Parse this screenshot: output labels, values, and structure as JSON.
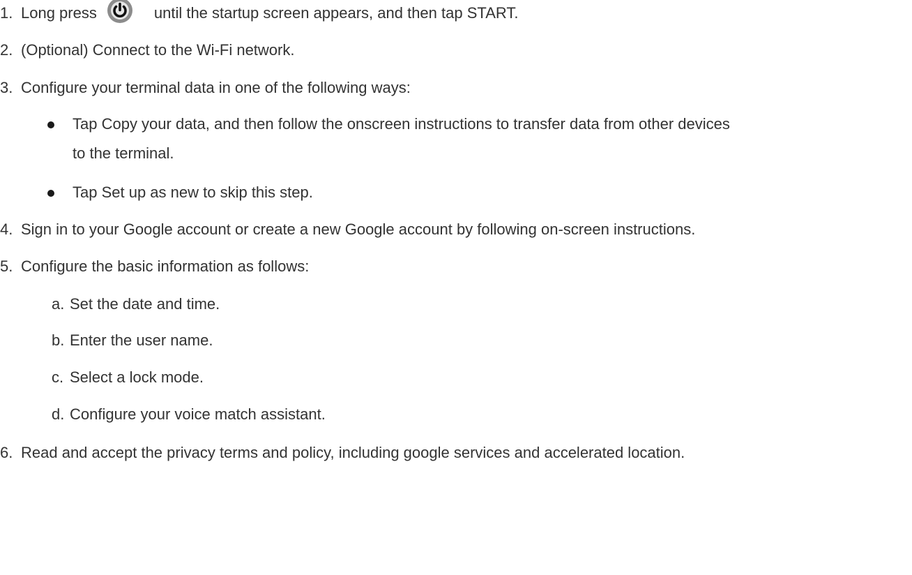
{
  "steps": [
    {
      "num": "1.",
      "before": "Long press",
      "after": "until the startup screen appears, and then tap START.",
      "icon": "power-icon"
    },
    {
      "num": "2.",
      "text": "(Optional) Connect to the Wi-Fi network."
    },
    {
      "num": "3.",
      "text": "Configure your terminal data in one of the following ways:"
    },
    {
      "num": "4.",
      "text": "Sign in to your Google account or create a new Google account by following on-screen instructions."
    },
    {
      "num": "5.",
      "text": "Configure the basic information as follows:"
    },
    {
      "num": "6.",
      "text": "Read and accept the privacy terms and policy, including google services and accelerated location."
    }
  ],
  "bullets": [
    {
      "line1": "Tap Copy your data, and then follow the onscreen instructions to transfer data from other devices",
      "line2": "to the terminal."
    },
    {
      "line1": "Tap Set up as new to skip this step."
    }
  ],
  "substeps": [
    {
      "letter": "a.",
      "text": "Set the date and time."
    },
    {
      "letter": "b.",
      "text": "Enter the user name."
    },
    {
      "letter": "c.",
      "text": "Select a lock mode."
    },
    {
      "letter": "d.",
      "text": "Configure your voice match assistant."
    }
  ],
  "colors": {
    "text": "#333333",
    "icon_bg": "#8c8c8c",
    "icon_fg": "#111111"
  }
}
